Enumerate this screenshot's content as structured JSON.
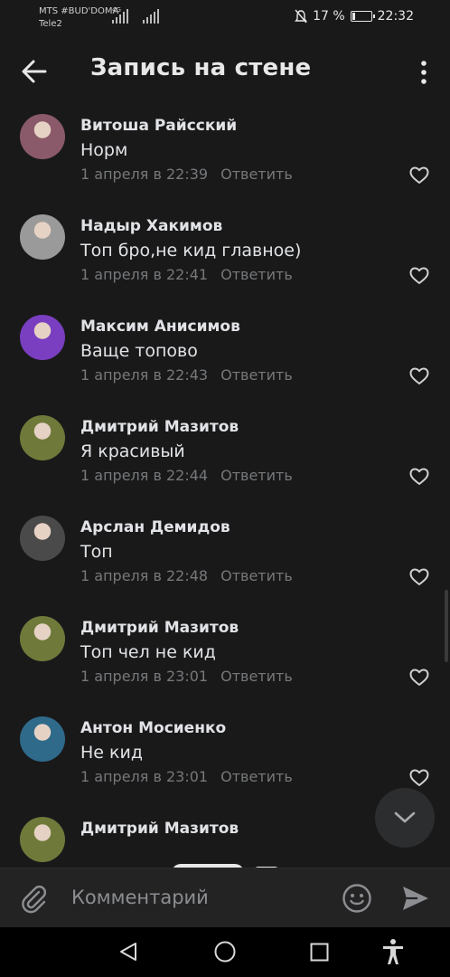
{
  "status_bar": {
    "carrier1": "MTS #BUD'DOMA",
    "carrier2": "Tele2",
    "network": "4G",
    "battery_percent": "17 %",
    "battery_level": 0.17,
    "time": "22:32"
  },
  "header": {
    "title": "Запись на стене"
  },
  "comments": [
    {
      "author": "Витоша Райсский",
      "text": "Норм",
      "time": "1 апреля в 22:39",
      "reply": "Ответить",
      "avatar_color": "#8a5a6a"
    },
    {
      "author": "Надыр Хакимов",
      "text": "Топ бро,не кид главное)",
      "time": "1 апреля в 22:41",
      "reply": "Ответить",
      "avatar_color": "#9a9a9a"
    },
    {
      "author": "Максим Анисимов",
      "text": "Ваще топово",
      "time": "1 апреля в 22:43",
      "reply": "Ответить",
      "avatar_color": "#7a3fc0"
    },
    {
      "author": "Дмитрий Мазитов",
      "text": "Я красивый",
      "time": "1 апреля в 22:44",
      "reply": "Ответить",
      "avatar_color": "#6f7a3a"
    },
    {
      "author": "Арслан Демидов",
      "text": "Топ",
      "time": "1 апреля в 22:48",
      "reply": "Ответить",
      "avatar_color": "#4a4a4a"
    },
    {
      "author": "Дмитрий Мазитов",
      "text": "Топ чел не кид",
      "time": "1 апреля в 23:01",
      "reply": "Ответить",
      "avatar_color": "#6f7a3a"
    },
    {
      "author": "Антон Мосиенко",
      "text": "Не кид",
      "time": "1 апреля в 23:01",
      "reply": "Ответить",
      "avatar_color": "#2f6a8a"
    },
    {
      "author": "Дмитрий Мазитов",
      "text": "",
      "time": "",
      "reply": "",
      "avatar_color": "#6f7a3a"
    }
  ],
  "composer": {
    "placeholder": "Комментарий"
  },
  "icons": {
    "back": "arrow-left-icon",
    "more": "more-vertical-icon",
    "like": "heart-outline-icon",
    "scroll_down": "chevron-down-icon",
    "attach": "paperclip-icon",
    "emoji": "smiley-icon",
    "send": "send-icon"
  }
}
